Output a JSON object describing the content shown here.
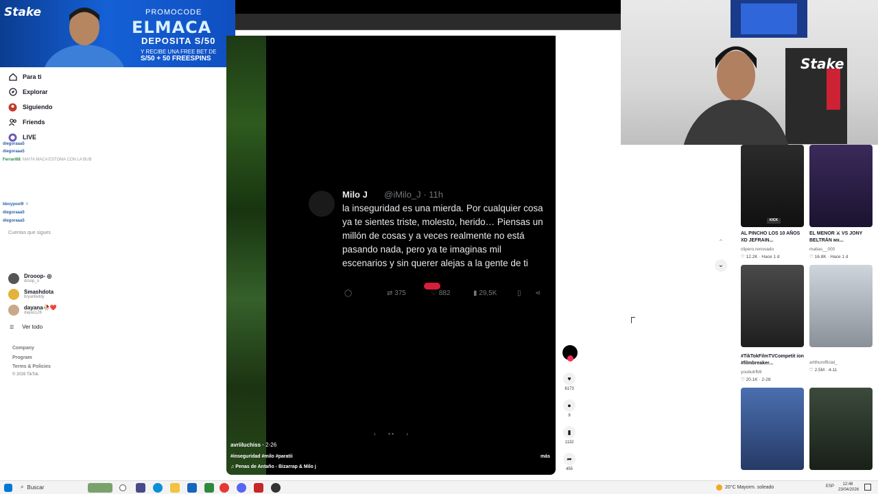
{
  "promo": {
    "brand": "Stake",
    "code_label": "PROMOCODE",
    "code": "ELMACA",
    "deposit": "DEPOSITA S/50",
    "freebet": "Y RECIBE UNA FREE BET DE",
    "bonus": "S/50 + 50 FREESPINS"
  },
  "sidebar": {
    "nav": [
      {
        "label": "Para ti",
        "icon": "home-icon"
      },
      {
        "label": "Explorar",
        "icon": "compass-icon"
      },
      {
        "label": "Siguiendo",
        "icon": "following-icon"
      },
      {
        "label": "Friends",
        "icon": "friends-icon"
      },
      {
        "label": "LIVE",
        "icon": "live-icon"
      }
    ],
    "following_title": "Cuentas que sigues",
    "following": [
      {
        "name": "Droo​op- ◎",
        "handle": "droop_o",
        "color": "#555"
      },
      {
        "name": "Smashdota",
        "handle": "bryanfeddy",
        "color": "#e2b33a"
      },
      {
        "name": "dayana🥀❤️",
        "handle": "daya1126",
        "color": "#c9a98b"
      }
    ],
    "see_all": "Ver todo",
    "footer": [
      "Company",
      "Program",
      "Terms & Policies"
    ],
    "copyright": "© 2026 TikTok"
  },
  "chat": [
    {
      "user": "diegoraaa5",
      "text": ""
    },
    {
      "user": "diegoraaa5",
      "text": ""
    },
    {
      "user": "Ferrari68",
      "text": ": MAITA MACA ESTOMA CON LA BUB"
    },
    {
      "user": "bboypool9",
      "text": ": 4"
    },
    {
      "user": "diegoraaa5",
      "text": ""
    },
    {
      "user": "diegoraaa5",
      "text": ""
    }
  ],
  "video": {
    "tweet": {
      "name": "Milo J",
      "handle": "@iMilo_J · 11h",
      "text": "la inseguridad es una mierda. Por cualquier cosa ya te sientes triste, molesto, herido… Piensas un millón de cosas y a veces realmente no está pasando nada, pero ya te imaginas mil escenarios y sin querer alejas a la gente de ti",
      "retweets": "375",
      "likes": "882",
      "views": "29,5K"
    },
    "author": "avriiluchiss",
    "date": "2-26",
    "tags": "#inseguridad #milo #paratii",
    "song": "♫  Penas de Antaño - Bizarrap & Milo j",
    "more": "más",
    "actions": {
      "likes": "6173",
      "comments": "9",
      "saves": "1132",
      "shares": "455"
    }
  },
  "grid": [
    {
      "caption": "AL PINCHO LOS 10 AÑOS XD JEFRAIN...",
      "author": "clipero.renovado",
      "likes": "12.2K",
      "date": "Hace 1 d"
    },
    {
      "caption": "EL MENOR ⚔ VS JONY BELTRÁN мх...",
      "author": "matias__000",
      "likes": "16.8K",
      "date": "Hace 1 d"
    },
    {
      "caption": "#TikTokFilmTVCompetit ion #filmbreaker...",
      "author": "youbulrfb9",
      "likes": "20.1K",
      "date": "2-28"
    },
    {
      "caption": "",
      "author": "artthurofficial_",
      "likes": "2.5M",
      "date": "4-11"
    }
  ],
  "taskbar": {
    "search": "Buscar",
    "weather": "20°C  Mayorm. soleado",
    "lang": "ESP",
    "time": "12:48",
    "date": "23/04/2026"
  },
  "colors": {
    "tiktok_red": "#fe2c55",
    "stake_blue": "#1560d6"
  }
}
